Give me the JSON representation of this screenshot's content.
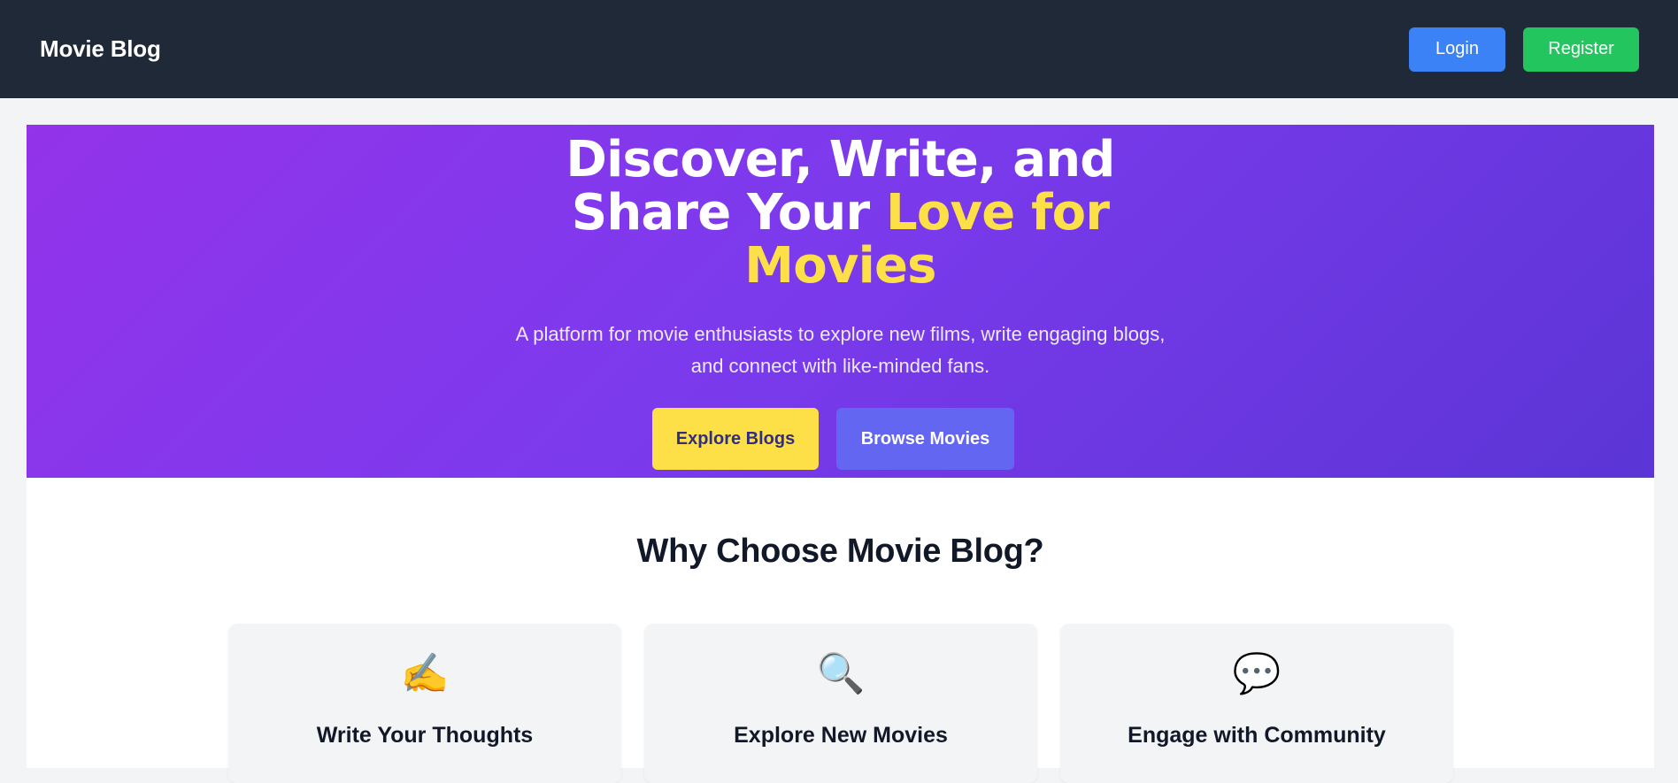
{
  "navbar": {
    "brand": "Movie Blog",
    "login_label": "Login",
    "register_label": "Register"
  },
  "hero": {
    "title_line1": "Discover, Write, and",
    "title_line2_plain": "Share Your ",
    "title_line2_accent": "Love for",
    "title_line3_accent": "Movies",
    "subtitle_line1": "A platform for movie enthusiasts to explore new films, write engaging blogs,",
    "subtitle_line2": "and connect with like-minded fans.",
    "explore_label": "Explore Blogs",
    "browse_label": "Browse Movies"
  },
  "features": {
    "title": "Why Choose Movie Blog?",
    "cards": [
      {
        "icon": "writing-hand-icon",
        "glyph": "✍️",
        "title": "Write Your Thoughts"
      },
      {
        "icon": "magnifying-glass-icon",
        "glyph": "🔍",
        "title": "Explore New Movies"
      },
      {
        "icon": "speech-bubble-icon",
        "glyph": "💬",
        "title": "Engage with Community"
      }
    ]
  },
  "colors": {
    "navbar_bg": "#1f2937",
    "login_btn": "#3b82f6",
    "register_btn": "#22c55e",
    "hero_gradient_start": "#9333ea",
    "hero_gradient_end": "#5b35d5",
    "accent_yellow": "#fde047",
    "browse_btn": "#6366f1"
  }
}
